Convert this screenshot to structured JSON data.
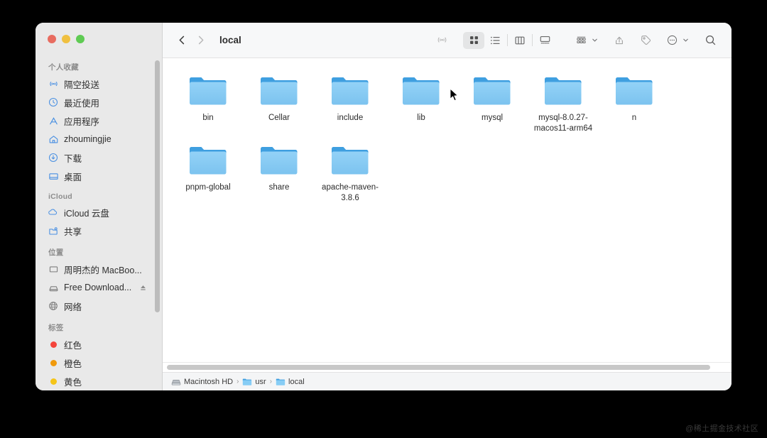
{
  "window": {
    "traffic_lights": [
      {
        "name": "close",
        "color": "#e86c60"
      },
      {
        "name": "minimize",
        "color": "#f0c040"
      },
      {
        "name": "maximize",
        "color": "#5fcb53"
      }
    ]
  },
  "sidebar": {
    "sections": [
      {
        "title": "个人收藏",
        "items": [
          {
            "label": "隔空投送",
            "icon": "airdrop-icon"
          },
          {
            "label": "最近使用",
            "icon": "clock-icon"
          },
          {
            "label": "应用程序",
            "icon": "applications-icon"
          },
          {
            "label": "zhoumingjie",
            "icon": "home-icon"
          },
          {
            "label": "下载",
            "icon": "downloads-icon"
          },
          {
            "label": "桌面",
            "icon": "desktop-icon"
          }
        ]
      },
      {
        "title": "iCloud",
        "items": [
          {
            "label": "iCloud 云盘",
            "icon": "cloud-icon"
          },
          {
            "label": "共享",
            "icon": "shared-folder-icon"
          }
        ]
      },
      {
        "title": "位置",
        "items": [
          {
            "label": "周明杰的 MacBoo...",
            "icon": "laptop-icon"
          },
          {
            "label": "Free Download...",
            "icon": "disk-icon",
            "eject": true
          },
          {
            "label": "网络",
            "icon": "network-icon"
          }
        ]
      },
      {
        "title": "标签",
        "items": [
          {
            "label": "红色",
            "icon": "tag-dot-icon",
            "color": "#f4453c"
          },
          {
            "label": "橙色",
            "icon": "tag-dot-icon",
            "color": "#f09a0c"
          },
          {
            "label": "黄色",
            "icon": "tag-dot-icon",
            "color": "#f5c518"
          }
        ]
      }
    ]
  },
  "toolbar": {
    "back_icon": "chevron-left-icon",
    "forward_icon": "chevron-right-icon",
    "title": "local",
    "airdrop_icon": "airdrop-icon",
    "views": [
      {
        "name": "icon-view",
        "icon": "grid-icon",
        "selected": true
      },
      {
        "name": "list-view",
        "icon": "list-icon",
        "selected": false
      },
      {
        "name": "column-view",
        "icon": "columns-icon",
        "selected": false
      },
      {
        "name": "gallery-view",
        "icon": "gallery-icon",
        "selected": false
      }
    ],
    "group_icon": "group-by-icon",
    "share_icon": "share-icon",
    "tag_icon": "tag-icon",
    "more_icon": "more-ellipsis-icon",
    "search_icon": "search-icon"
  },
  "files": [
    {
      "name": "bin",
      "type": "folder"
    },
    {
      "name": "Cellar",
      "type": "folder"
    },
    {
      "name": "include",
      "type": "folder"
    },
    {
      "name": "lib",
      "type": "folder"
    },
    {
      "name": "mysql",
      "type": "folder"
    },
    {
      "name": "mysql-8.0.27-macos11-arm64",
      "type": "folder"
    },
    {
      "name": "n",
      "type": "folder"
    },
    {
      "name": "pnpm-global",
      "type": "folder"
    },
    {
      "name": "share",
      "type": "folder"
    },
    {
      "name": "apache-maven-3.8.6",
      "type": "folder"
    }
  ],
  "pathbar": {
    "segments": [
      {
        "label": "Macintosh HD",
        "icon": "hard-disk-icon"
      },
      {
        "label": "usr",
        "icon": "folder-icon"
      },
      {
        "label": "local",
        "icon": "folder-icon"
      }
    ],
    "separator": "›"
  },
  "watermark": {
    "text": "@稀土掘金技术社区"
  },
  "colors": {
    "folder_top": "#3f9fe0",
    "folder_body": "#87cdf5",
    "sidebar_bg": "#e9e9e9",
    "toolbar_bg": "#f7f8f9",
    "accent": "#4a90e2"
  }
}
